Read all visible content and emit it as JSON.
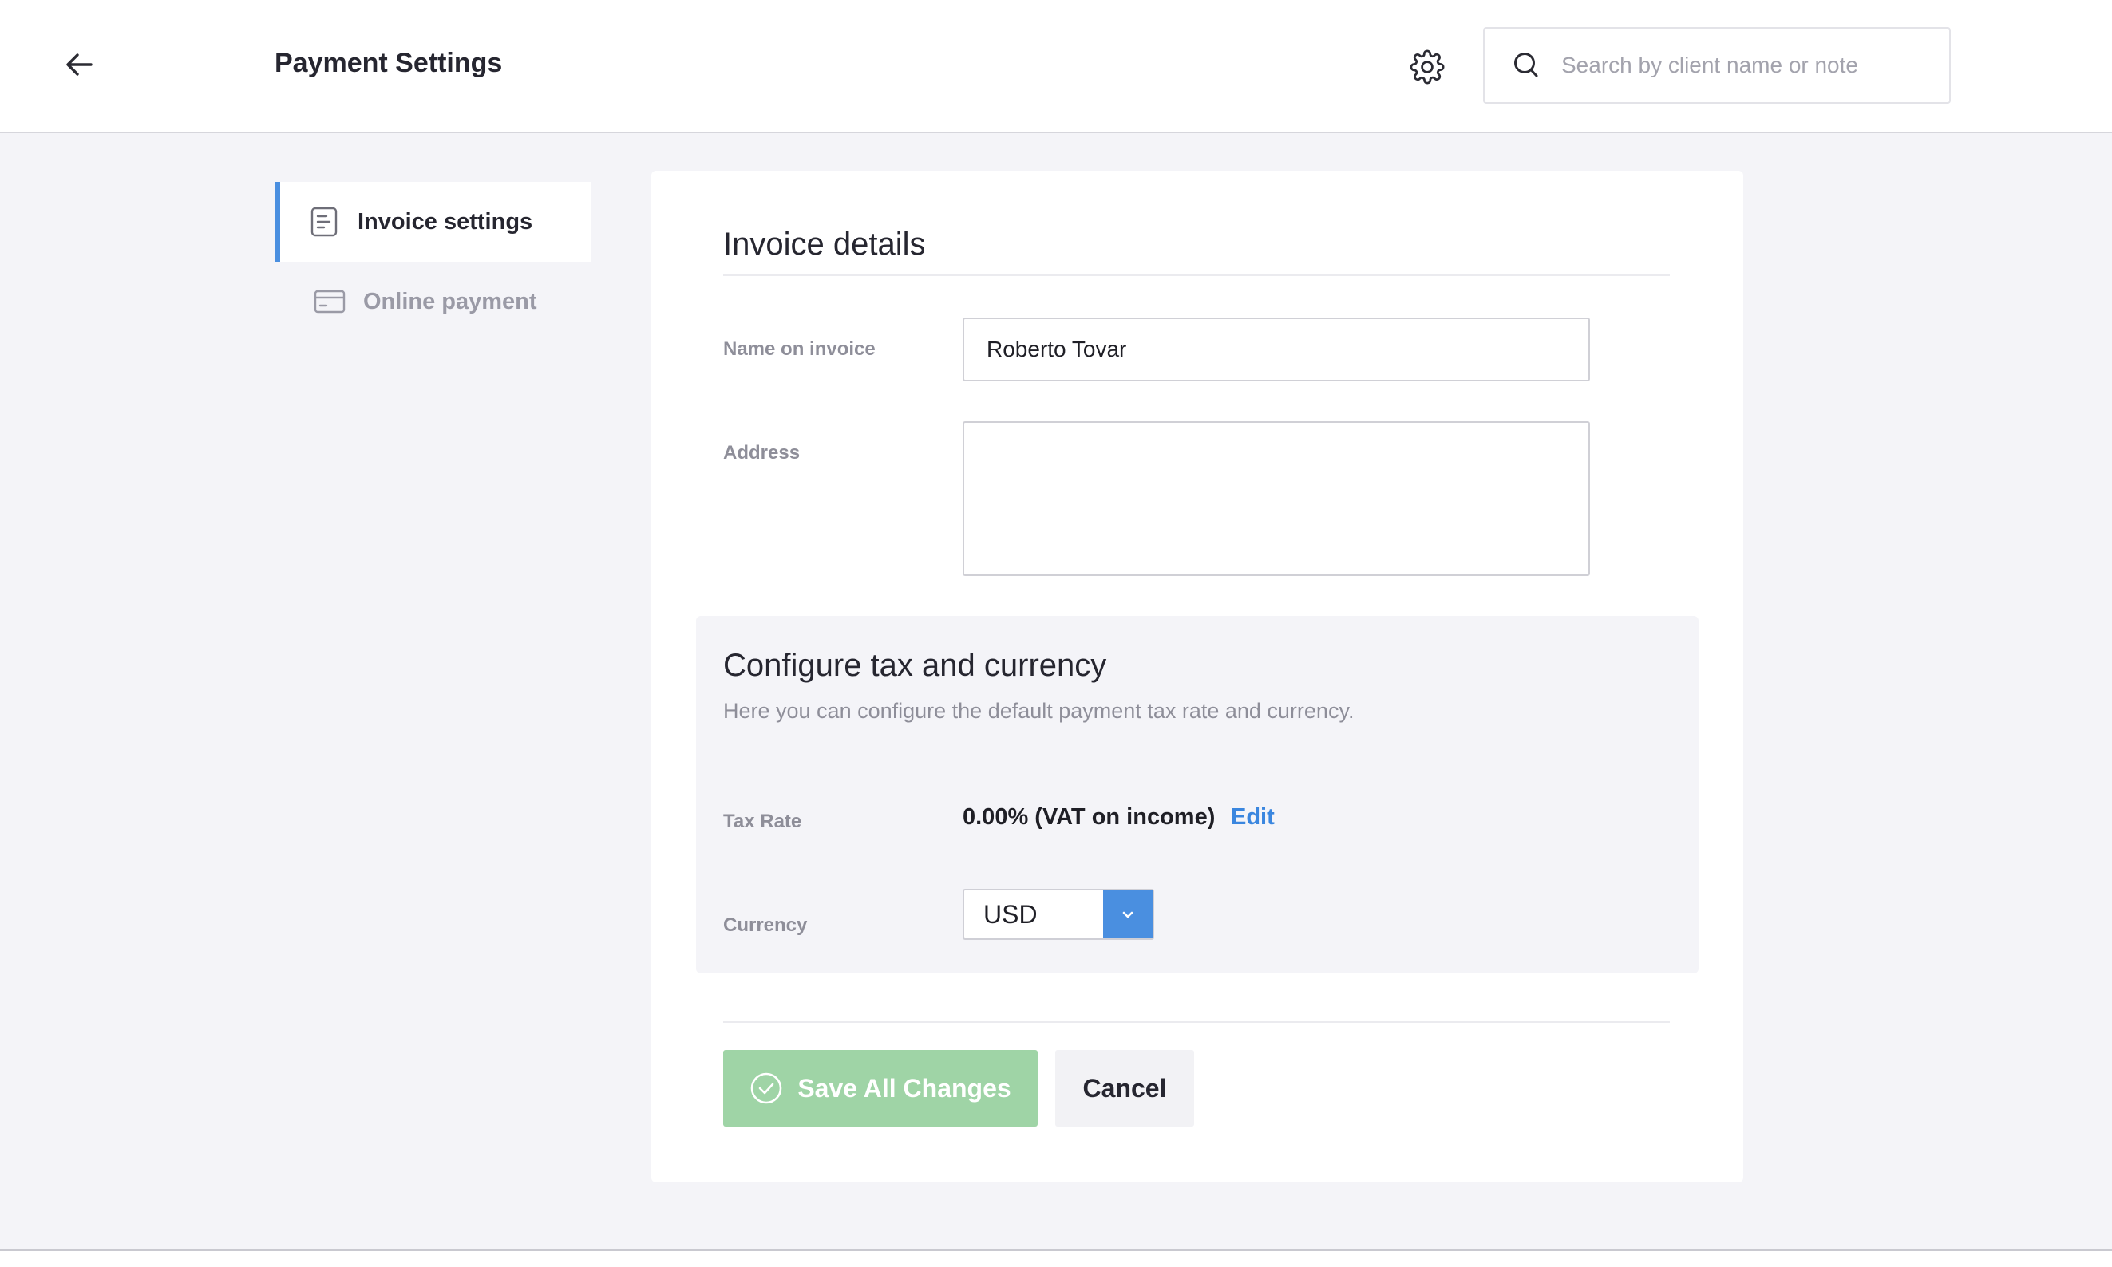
{
  "header": {
    "title": "Payment Settings",
    "back_icon": "arrow-left-icon",
    "settings_icon": "gear-icon",
    "search": {
      "placeholder": "Search by client name or note",
      "value": "",
      "icon": "search-icon"
    }
  },
  "sidebar": {
    "items": [
      {
        "label": "Invoice settings",
        "icon": "document-icon",
        "active": true
      },
      {
        "label": "Online payment",
        "icon": "credit-card-icon",
        "active": false
      }
    ]
  },
  "invoice": {
    "section_title": "Invoice details",
    "name_label": "Name on invoice",
    "name_value": "Roberto Tovar",
    "address_label": "Address",
    "address_value": ""
  },
  "tax": {
    "title": "Configure tax and currency",
    "subtitle": "Here you can configure the default payment tax rate and currency.",
    "rate_label": "Tax Rate",
    "rate_value": "0.00% (VAT on income)",
    "edit_label": "Edit",
    "currency_label": "Currency",
    "currency_value": "USD"
  },
  "actions": {
    "save_label": "Save All Changes",
    "cancel_label": "Cancel"
  },
  "colors": {
    "accent": "#4a8fe0",
    "link": "#3a86df",
    "save_disabled": "#9fd4a6",
    "background": "#f4f4f8"
  }
}
